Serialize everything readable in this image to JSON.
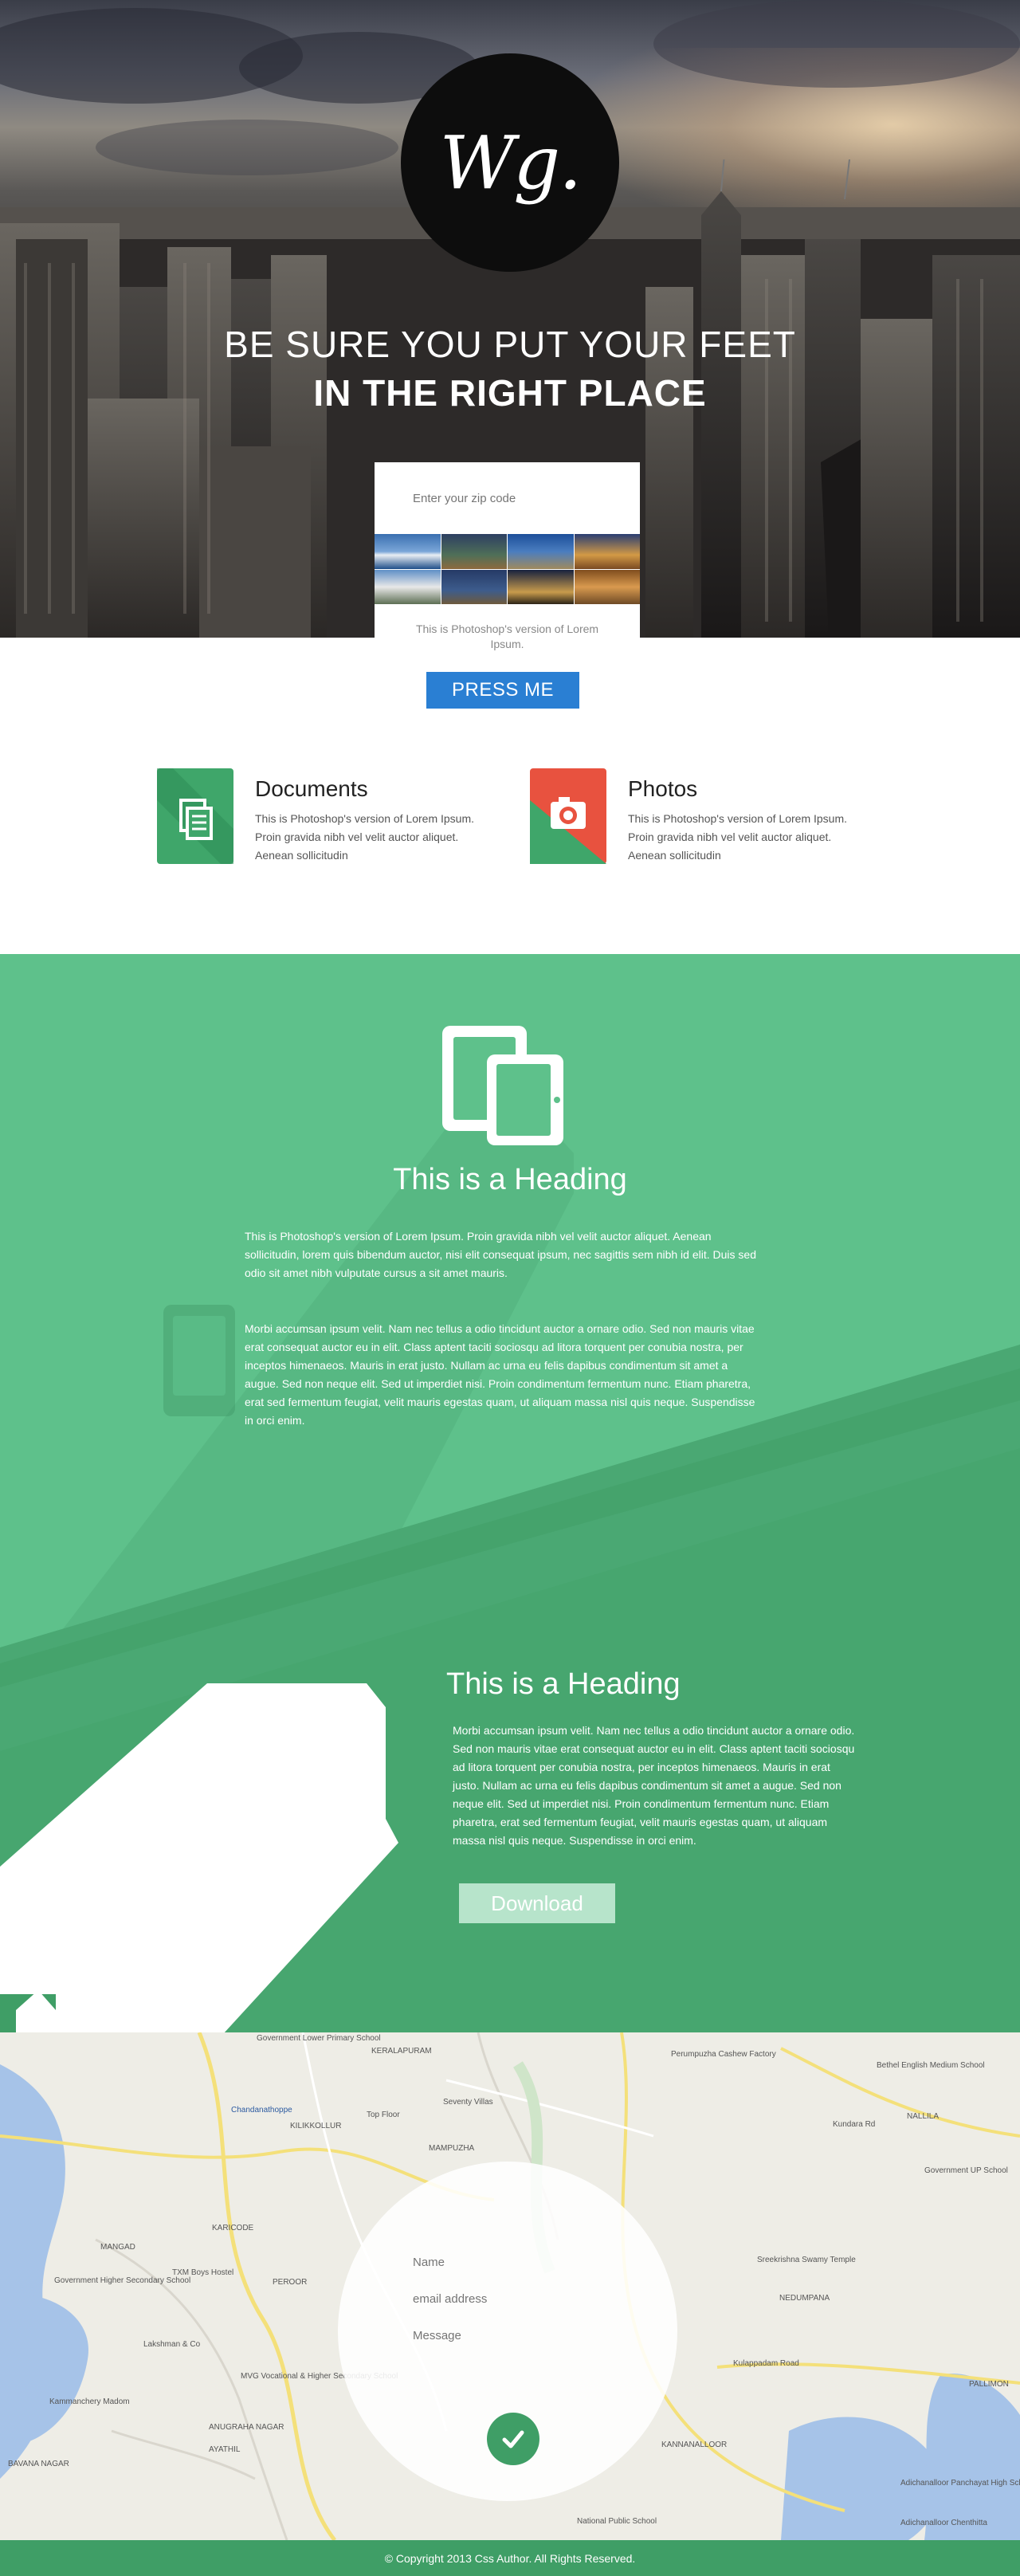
{
  "hero": {
    "logo_text": "Wg.",
    "headline_light": "BE SURE YOU PUT YOUR FEET",
    "headline_bold": "IN THE RIGHT PLACE",
    "zip_placeholder": "Enter your zip code",
    "zip_caption": "This is Photoshop's version  of Lorem Ipsum.",
    "cta_label": "PRESS ME"
  },
  "features": [
    {
      "title": "Documents",
      "text": "This is Photoshop's version  of Lorem Ipsum. Proin gravida nibh vel velit auctor aliquet. Aenean sollicitudin",
      "icon": "documents-icon"
    },
    {
      "title": "Photos",
      "text": "This is Photoshop's version  of Lorem Ipsum. Proin gravida nibh vel velit auctor aliquet. Aenean sollicitudin",
      "icon": "camera-icon"
    }
  ],
  "section1": {
    "heading": "This is a Heading",
    "para1": "This is Photoshop's version  of Lorem Ipsum. Proin gravida nibh vel velit auctor aliquet. Aenean sollicitudin, lorem quis bibendum auctor, nisi elit consequat ipsum, nec sagittis sem nibh id elit. Duis sed odio sit amet nibh vulputate cursus a sit amet mauris.",
    "para2": "Morbi accumsan ipsum velit. Nam nec tellus a odio tincidunt auctor a ornare odio. Sed non  mauris vitae erat consequat auctor eu in elit. Class aptent taciti sociosqu ad litora torquent per conubia nostra, per inceptos himenaeos. Mauris in erat justo. Nullam ac urna eu felis dapibus condimentum sit amet a augue. Sed non neque elit. Sed ut imperdiet nisi. Proin condimentum fermentum nunc. Etiam pharetra, erat sed fermentum feugiat, velit mauris egestas quam, ut aliquam massa nisl quis neque. Suspendisse in orci enim."
  },
  "section2": {
    "heading": "This is a Heading",
    "para": "Morbi accumsan ipsum velit. Nam nec tellus a odio tincidunt auctor a ornare odio. Sed non  mauris vitae erat consequat auctor eu in elit. Class aptent taciti sociosqu ad litora torquent per conubia nostra, per inceptos himenaeos. Mauris in erat justo. Nullam ac urna eu felis dapibus condimentum sit amet a augue. Sed non neque elit. Sed ut imperdiet nisi. Proin condimentum fermentum nunc. Etiam pharetra, erat sed fermentum feugiat, velit mauris egestas quam, ut aliquam massa nisl quis neque. Suspendisse in orci enim.",
    "button": "Download"
  },
  "map": {
    "labels": [
      "Government Lower Primary School",
      "KERALAPURAM",
      "Perumpuzha Cashew Factory",
      "Bethel English Medium School",
      "Chandanathoppe",
      "KILIKKOLLUR",
      "Top Floor",
      "Seventy Villas",
      "Kundara Rd",
      "NALLILA",
      "MAMPUZHA",
      "Government UP School",
      "MANGAD",
      "KARICODE",
      "TXM Boys Hostel",
      "PEROOR",
      "Government Higher Secondary School",
      "Sreekrishna Swamy Temple",
      "NEDUMPANA",
      "Lakshman & Co",
      "MVG Vocational & Higher Secondary School",
      "Kulappadam Road",
      "PALLIMON",
      "Kammanchery Madom",
      "ANUGRAHA NAGAR",
      "AYATHIL",
      "KANNANALLOOR",
      "BAVANA NAGAR",
      "National Public School",
      "Adichanalloor Panchayat High School",
      "Adichanalloor Chenthitta"
    ],
    "form": {
      "name_placeholder": "Name",
      "email_placeholder": "email address",
      "message_placeholder": "Message"
    }
  },
  "footer": {
    "copyright": "© Copyright 2013 Css Author. All Rights Reserved."
  },
  "colors": {
    "green": "#5ec18b",
    "green_dark": "#3f9e66",
    "blue_button": "#2a7fd3",
    "doc_icon": "#3fa66a",
    "photo_icon_red": "#e8523f"
  }
}
